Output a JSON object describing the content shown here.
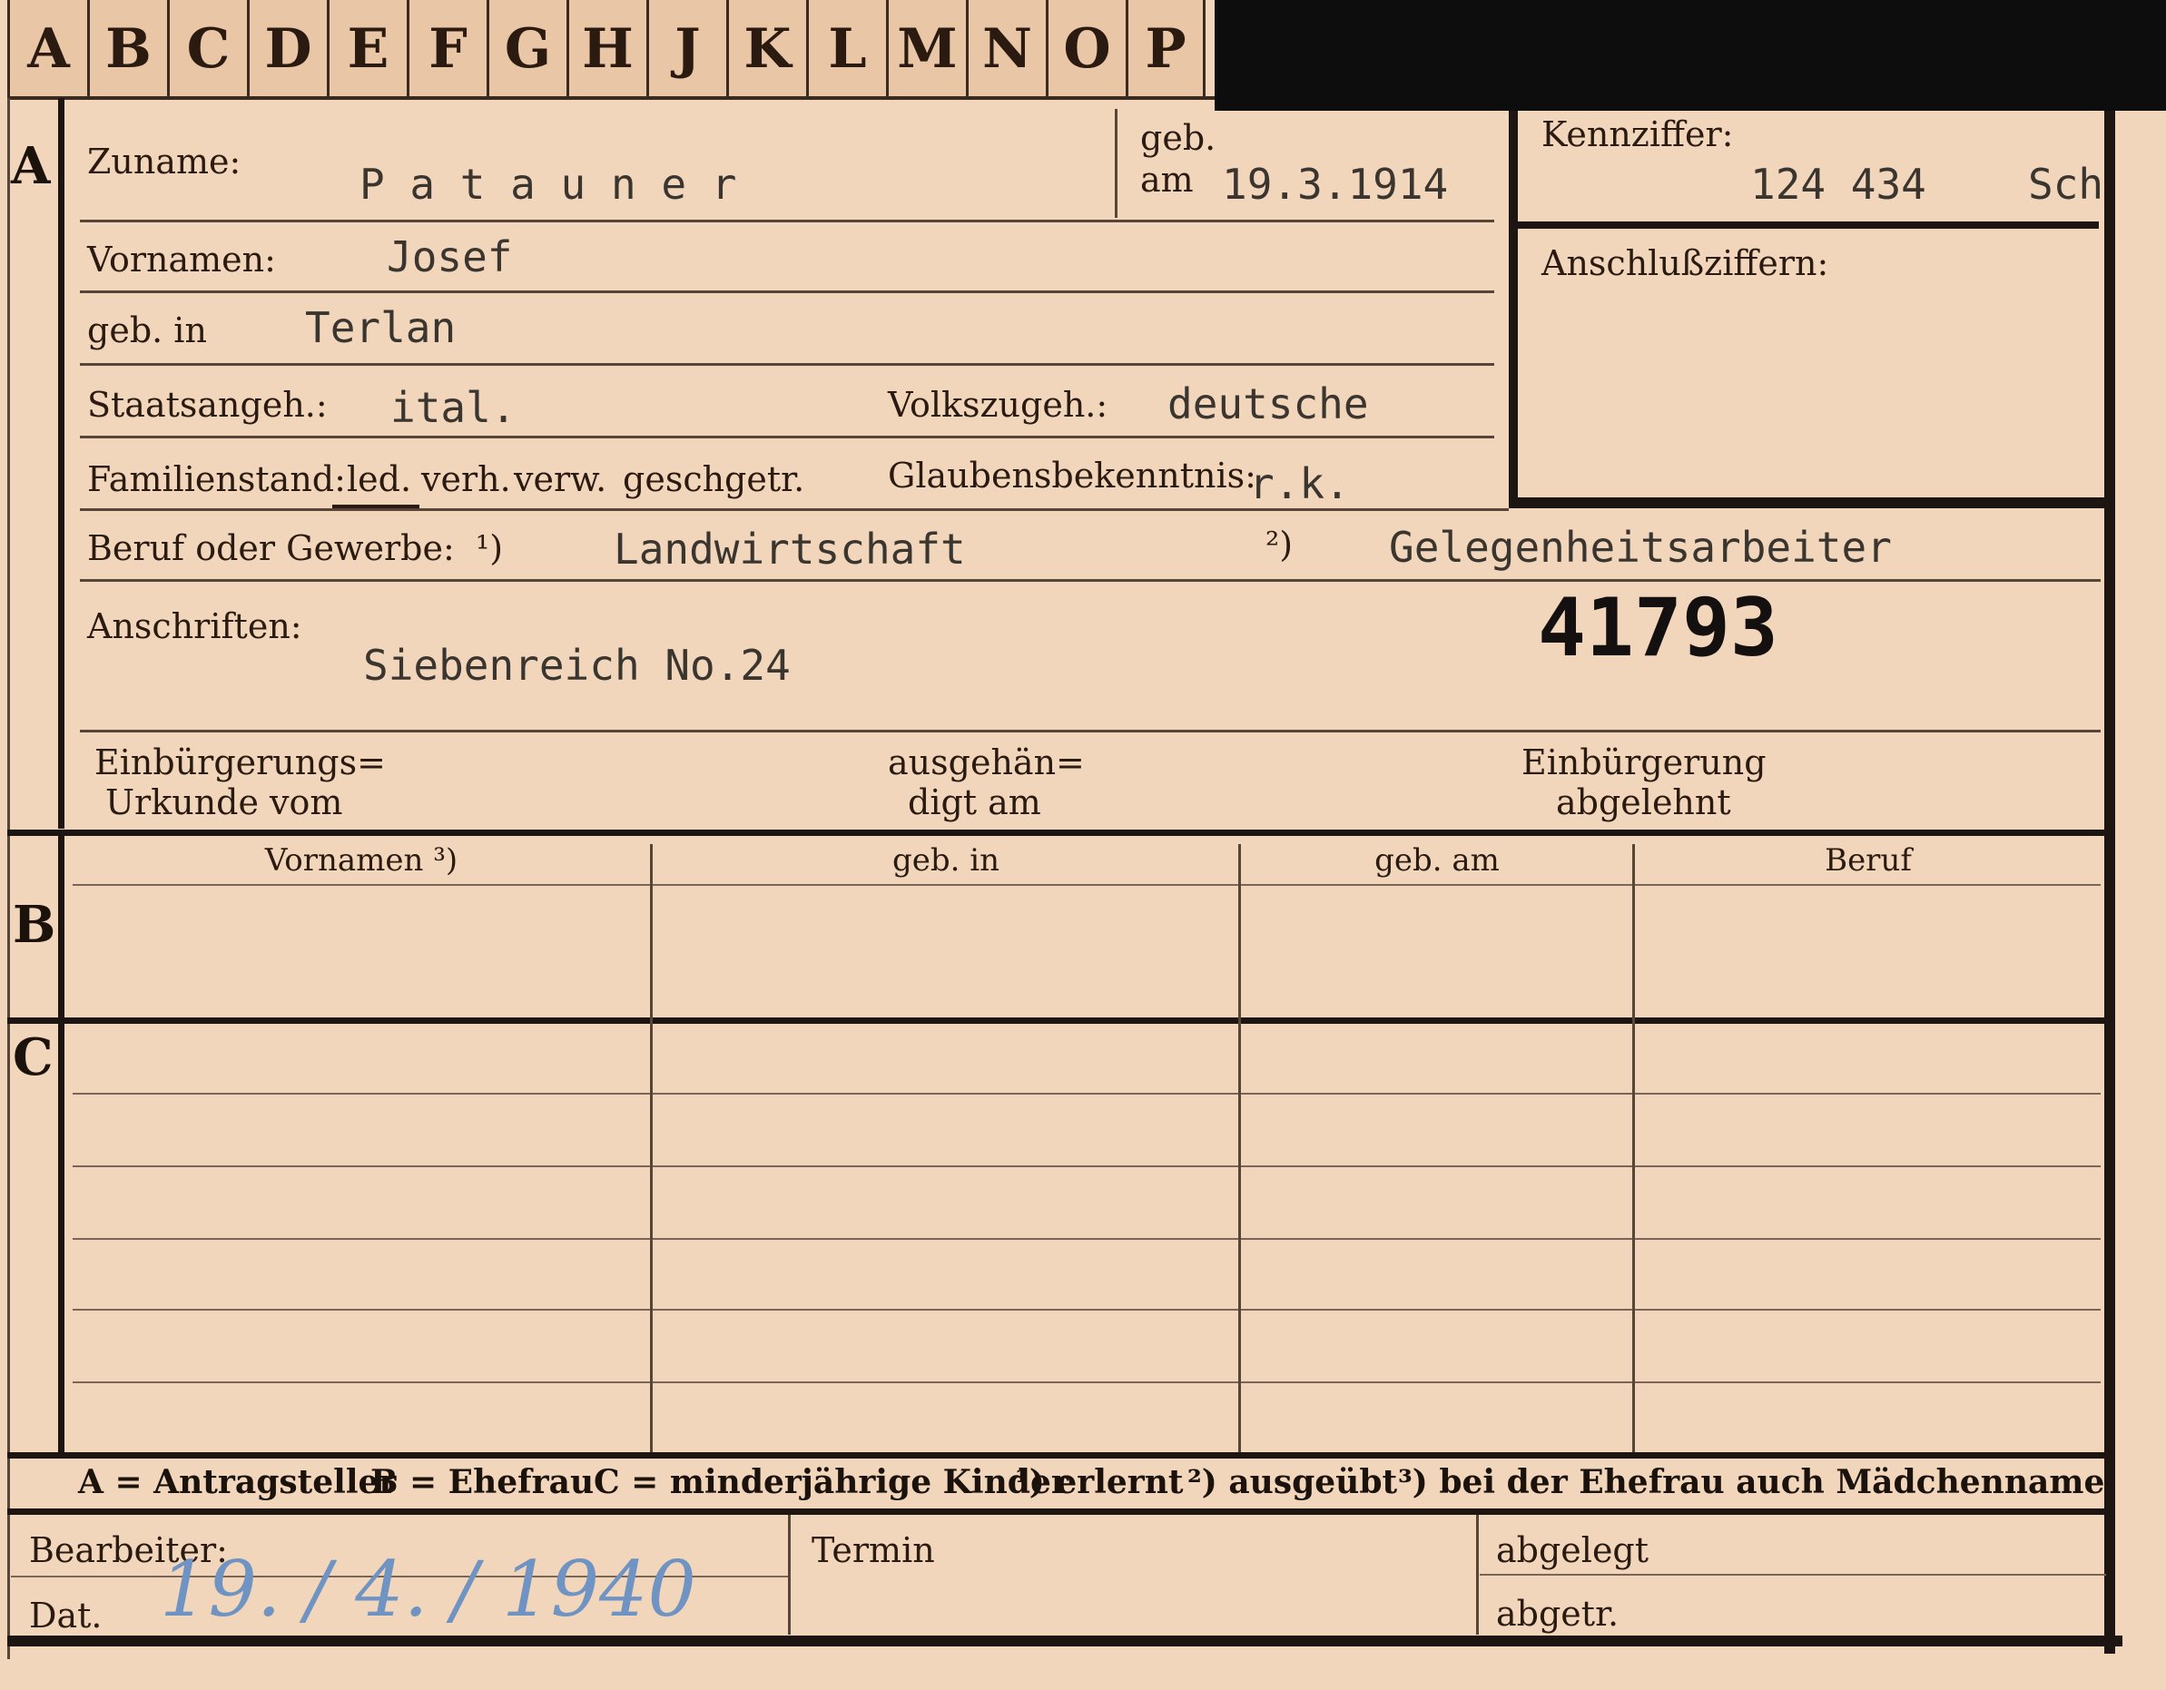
{
  "tabs": [
    "A",
    "B",
    "C",
    "D",
    "E",
    "F",
    "G",
    "H",
    "J",
    "K",
    "L",
    "M",
    "N",
    "O",
    "P"
  ],
  "sections": {
    "a": "A",
    "b": "B",
    "c": "C"
  },
  "fields": {
    "zuname_label": "Zuname:",
    "zuname_value": "P a t a u n e r",
    "geb_label": "geb.",
    "am_label": "am",
    "geb_am_value": "19.3.1914",
    "kennziffer_label": "Kennziffer:",
    "kennziffer_value": "124 434",
    "kennziffer_suffix": "Sch",
    "anschluss_label": "Anschlußziffern:",
    "vornamen_label": "Vornamen:",
    "vornamen_value": "Josef",
    "gebin_label": "geb. in",
    "gebin_value": "Terlan",
    "staat_label": "Staatsangeh.:",
    "staat_value": "ital.",
    "volk_label": "Volkszugeh.:",
    "volk_value": "deutsche",
    "familien_label": "Familienstand:",
    "familien_options": [
      "led.",
      "verh.",
      "verw.",
      "gesch.",
      "getr."
    ],
    "glauben_label": "Glaubensbekenntnis:",
    "glauben_value": "r.k.",
    "beruf_label": "Beruf oder Gewerbe:",
    "beruf_mark1": "¹)",
    "beruf_value1": "Landwirtschaft",
    "beruf_mark2": "²)",
    "beruf_value2": "Gelegenheitsarbeiter",
    "anschriften_label": "Anschriften:",
    "anschriften_value": "Siebenreich No.24",
    "stamp_number": "41793",
    "einb_label1": "Einbürgerungs=",
    "einb_label2": "Urkunde vom",
    "ausg_label1": "ausgehän=",
    "ausg_label2": "digt am",
    "abgelehnt_label1": "Einbürgerung",
    "abgelehnt_label2": "abgelehnt"
  },
  "table_b": {
    "headers": [
      "Vornamen ³)",
      "geb. in",
      "geb. am",
      "Beruf"
    ]
  },
  "legend": {
    "a": "A = Antragsteller",
    "b": "B = Ehefrau",
    "c": "C = minderjährige Kinder",
    "n1": "¹) erlernt",
    "n2": "²) ausgeübt",
    "n3": "³) bei der Ehefrau auch Mädchenname"
  },
  "footer": {
    "bearbeiter_label": "Bearbeiter:",
    "dat_label": "Dat.",
    "date_handwritten": "19. / 4. / 1940",
    "termin_label": "Termin",
    "abgelegt_label": "abgelegt",
    "abgetr_label": "abgetr."
  }
}
